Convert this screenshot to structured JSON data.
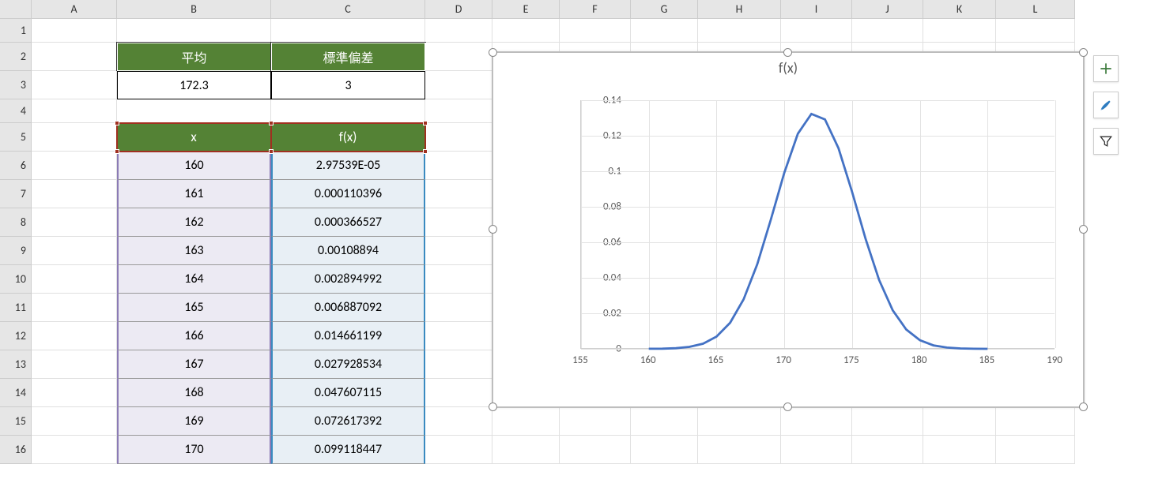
{
  "columns": [
    "A",
    "B",
    "C",
    "D",
    "E",
    "F",
    "G",
    "H",
    "I",
    "J",
    "K",
    "L"
  ],
  "rownums": [
    1,
    2,
    3,
    4,
    5,
    6,
    7,
    8,
    9,
    10,
    11,
    12,
    13,
    14,
    15,
    16
  ],
  "stats": {
    "mean_label": "平均",
    "std_label": "標準偏差",
    "mean_value": "172.3",
    "std_value": "3"
  },
  "table": {
    "x_header": "x",
    "fx_header": "f(x)",
    "rows": [
      {
        "x": "160",
        "fx": "2.97539E-05"
      },
      {
        "x": "161",
        "fx": "0.000110396"
      },
      {
        "x": "162",
        "fx": "0.000366527"
      },
      {
        "x": "163",
        "fx": "0.00108894"
      },
      {
        "x": "164",
        "fx": "0.002894992"
      },
      {
        "x": "165",
        "fx": "0.006887092"
      },
      {
        "x": "166",
        "fx": "0.014661199"
      },
      {
        "x": "167",
        "fx": "0.027928534"
      },
      {
        "x": "168",
        "fx": "0.047607115"
      },
      {
        "x": "169",
        "fx": "0.072617392"
      },
      {
        "x": "170",
        "fx": "0.099118447"
      }
    ]
  },
  "chart_data": {
    "type": "line",
    "title": "f(x)",
    "xlabel": "",
    "ylabel": "",
    "xlim": [
      155,
      190
    ],
    "ylim": [
      0,
      0.14
    ],
    "xticks": [
      155,
      160,
      165,
      170,
      175,
      180,
      185,
      190
    ],
    "yticks": [
      0,
      0.02,
      0.04,
      0.06,
      0.08,
      0.1,
      0.12,
      0.14
    ],
    "series": [
      {
        "name": "f(x)",
        "color": "#4472c4",
        "x": [
          160,
          161,
          162,
          163,
          164,
          165,
          166,
          167,
          168,
          169,
          170,
          171,
          172,
          173,
          174,
          175,
          176,
          177,
          178,
          179,
          180,
          181,
          182,
          183,
          184,
          185
        ],
        "y": [
          2.98e-05,
          0.00011,
          0.000367,
          0.00109,
          0.00289,
          0.00689,
          0.01466,
          0.02793,
          0.04761,
          0.07262,
          0.09912,
          0.12115,
          0.13233,
          0.12918,
          0.11297,
          0.08841,
          0.06189,
          0.03876,
          0.0217,
          0.01087,
          0.00487,
          0.00195,
          0.0007,
          0.000225,
          6.47e-05,
          1.66e-05
        ]
      }
    ]
  },
  "side_buttons": {
    "elements_tip": "Chart Elements",
    "styles_tip": "Chart Styles",
    "filters_tip": "Chart Filters"
  }
}
